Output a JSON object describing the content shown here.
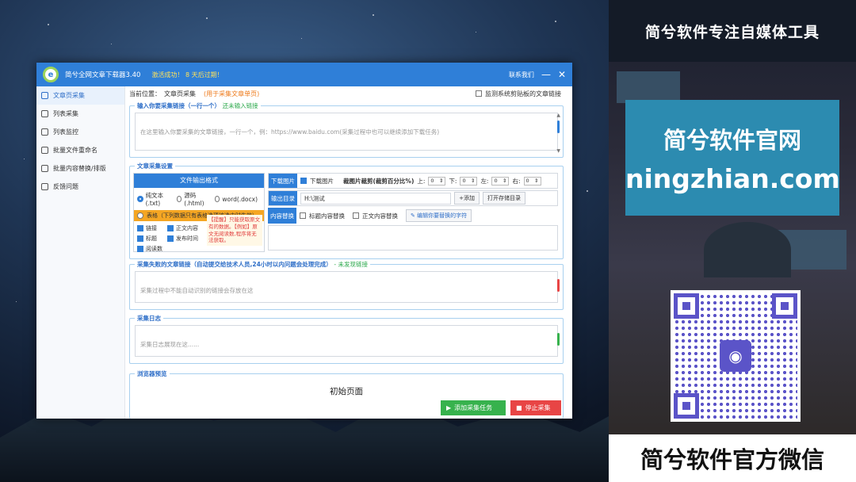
{
  "app": {
    "title": "简兮全网文章下载器3.40",
    "status": "激活成功！ 8 天后过期！",
    "contact": "联系我们",
    "minimize": "—",
    "close": "✕"
  },
  "sidebar": {
    "items": [
      {
        "label": "文章页采集",
        "icon": "list-icon",
        "active": true
      },
      {
        "label": "列表采集",
        "icon": "list-icon"
      },
      {
        "label": "列表监控",
        "icon": "monitor-icon"
      },
      {
        "label": "批量文件重命名",
        "icon": "rename-icon"
      },
      {
        "label": "批量内容替换/排版",
        "icon": "replace-icon"
      },
      {
        "label": "反馈问题",
        "icon": "feedback-icon"
      }
    ]
  },
  "breadcrumb": {
    "prefix": "当前位置：",
    "current": "文章页采集",
    "hint": "(用于采集文章单页)",
    "monitor_label": "监测系统剪贴板的文章链接"
  },
  "input_group": {
    "title": "输入你要采集链接（一行一个）",
    "status": "还未输入链接",
    "placeholder": "在这里输入你要采集的文章链接，一行一个，例：https://www.baidu.com(采集过程中也可以继续添加下载任务)"
  },
  "settings_group": {
    "title": "文章采集设置",
    "format_header": "文件输出格式",
    "formats": [
      "纯文本(.txt)",
      "源码(.html)",
      "word(.docx)"
    ],
    "table_option": "表格（下列数据只有表格选项被选中时生效）",
    "fields": [
      "链接",
      "正文内容",
      "标题",
      "发布时间",
      "阅读数"
    ],
    "tip": "【提醒】只能获取原文有的数据。【例如】原文无阅读数,程序将无法获取。",
    "download_images_label": "下载图片",
    "download_images_check": "下载图片",
    "crop_label": "裁图片裁剪(裁剪百分比%)",
    "crop_fields": [
      {
        "label": "上:",
        "value": "0"
      },
      {
        "label": "下:",
        "value": "0"
      },
      {
        "label": "左:",
        "value": "0"
      },
      {
        "label": "右:",
        "value": "0"
      }
    ],
    "output_dir_label": "输出目录",
    "output_dir": "H:\\测试",
    "add_button": "+添加",
    "open_dir_button": "打开存储目录",
    "replace_label": "内容替换",
    "replace_title": "标题内容替换",
    "replace_body": "正文内容替换",
    "edit_replace_button": "✎ 编辑你要替换的字符"
  },
  "failed_group": {
    "title": "采集失败的文章链接（自动提交给技术人员,24小时以内问题会处理完成）",
    "status": "- 未发现链接",
    "placeholder": "采集过程中不能自动识别的链接会存放在这"
  },
  "log_group": {
    "title": "采集日志",
    "placeholder": "采集日志展现在这......"
  },
  "preview_group": {
    "title": "浏览器预览",
    "page_title": "初始页面"
  },
  "actions": {
    "add_task": "添加采集任务",
    "stop": "停止采集"
  },
  "promo": {
    "top_banner": "简兮软件专注自媒体工具",
    "site_title": "简兮软件官网",
    "site_url": "ningzhian.com",
    "bottom_banner": "简兮软件官方微信",
    "accent": "#2c8bb0",
    "qr_color": "#5b54c8"
  },
  "colors": {
    "brand_blue": "#2f7fd8",
    "add_green": "#37b24d",
    "stop_red": "#e84545",
    "highlight_orange": "#f5a623"
  }
}
